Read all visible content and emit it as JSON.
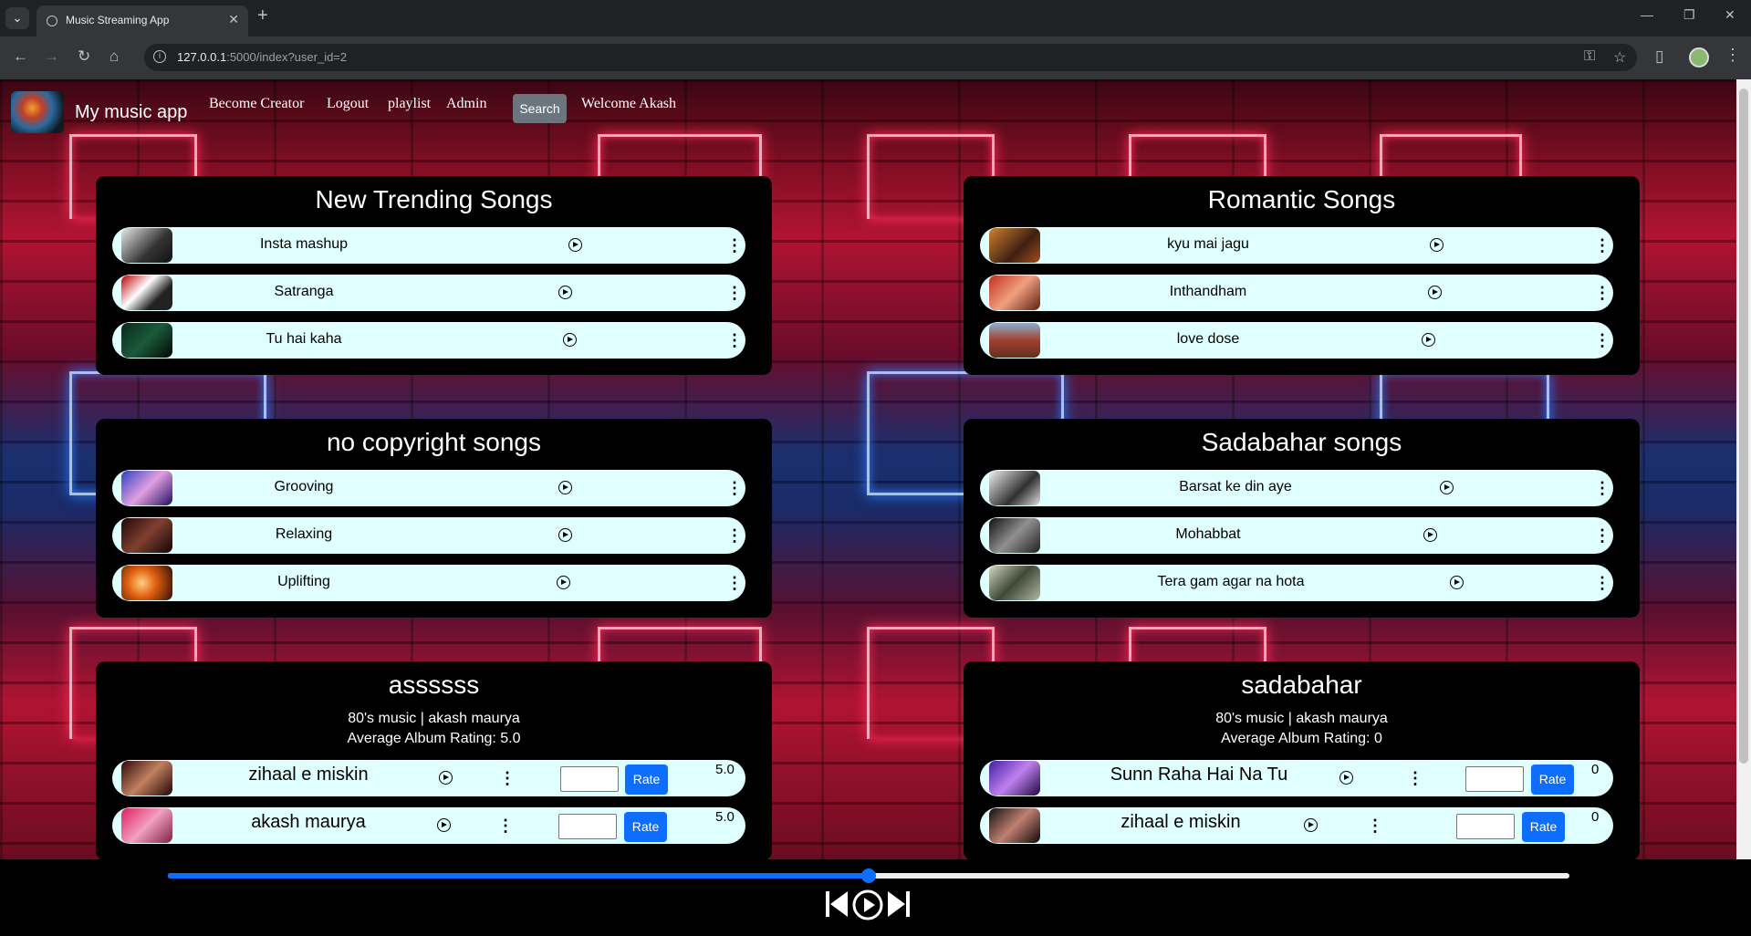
{
  "browser": {
    "tab_title": "Music Streaming App",
    "url_host": "127.0.0.1",
    "url_rest": ":5000/index?user_id=2"
  },
  "header": {
    "brand": "My music app",
    "nav": [
      "Become Creator",
      "Logout",
      "playlist",
      "Admin"
    ],
    "search_label": "Search",
    "welcome": "Welcome Akash"
  },
  "sections": [
    {
      "title": "New Trending Songs",
      "songs": [
        "Insta mashup",
        "Satranga",
        "Tu hai kaha"
      ]
    },
    {
      "title": "Romantic Songs",
      "songs": [
        "kyu mai jagu",
        "Inthandham",
        "love dose"
      ]
    },
    {
      "title": "no copyright songs",
      "songs": [
        "Grooving",
        "Relaxing",
        "Uplifting"
      ]
    },
    {
      "title": "Sadabahar songs",
      "songs": [
        "Barsat ke din aye",
        "Mohabbat",
        "Tera gam agar na hota"
      ]
    }
  ],
  "albums": [
    {
      "title": "assssss",
      "meta": "80's music | akash maurya",
      "avg_rating": "Average Album Rating: 5.0",
      "songs": [
        {
          "name": "zihaal e miskin",
          "rating": "5.0"
        },
        {
          "name": "akash maurya",
          "rating": "5.0"
        }
      ]
    },
    {
      "title": "sadabahar",
      "meta": "80's music | akash maurya",
      "avg_rating": "Average Album Rating: 0",
      "songs": [
        {
          "name": "Sunn Raha Hai Na Tu",
          "rating": "0"
        },
        {
          "name": "zihaal e miskin",
          "rating": "0"
        }
      ]
    }
  ],
  "rate_label": "Rate",
  "player": {
    "progress": 0.5
  },
  "colors": {
    "accent": "#0d6efd",
    "song_row": "#e0ffff",
    "card": "#000000"
  }
}
